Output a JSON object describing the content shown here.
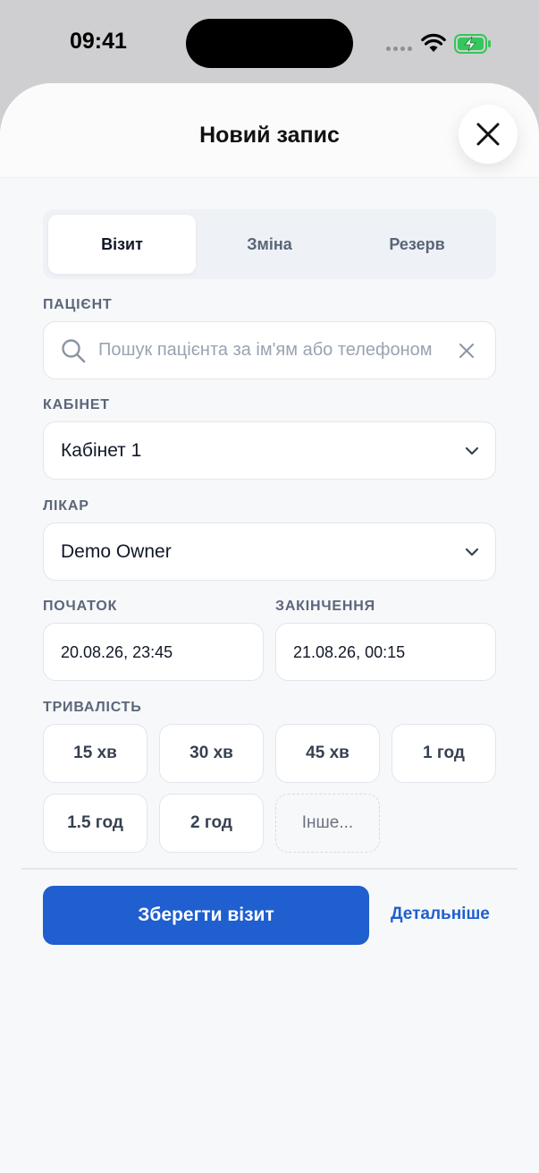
{
  "status_bar": {
    "time": "09:41"
  },
  "sheet": {
    "title": "Новий запис"
  },
  "tabs": [
    {
      "label": "Візит",
      "active": true
    },
    {
      "label": "Зміна",
      "active": false
    },
    {
      "label": "Резерв",
      "active": false
    }
  ],
  "patient": {
    "label": "ПАЦІЄНТ",
    "placeholder": "Пошук пацієнта за ім'ям або телефоном"
  },
  "cabinet": {
    "label": "КАБІНЕТ",
    "value": "Кабінет 1"
  },
  "doctor": {
    "label": "ЛІКАР",
    "value": "Demo Owner"
  },
  "start": {
    "label": "ПОЧАТОК",
    "value": "20.08.26, 23:45"
  },
  "end": {
    "label": "ЗАКІНЧЕННЯ",
    "value": "21.08.26, 00:15"
  },
  "duration": {
    "label": "ТРИВАЛІСТЬ",
    "options": [
      "15 хв",
      "30 хв",
      "45 хв",
      "1 год",
      "1.5 год",
      "2 год",
      "Інше..."
    ]
  },
  "actions": {
    "save_label": "Зберегти візит",
    "details_label": "Детальніше"
  },
  "colors": {
    "primary": "#1f5fcf",
    "battery": "#34c759"
  },
  "icons": [
    "search-icon",
    "clear-icon",
    "chevron-down-icon",
    "close-icon",
    "wifi-icon",
    "battery-charging-icon"
  ]
}
